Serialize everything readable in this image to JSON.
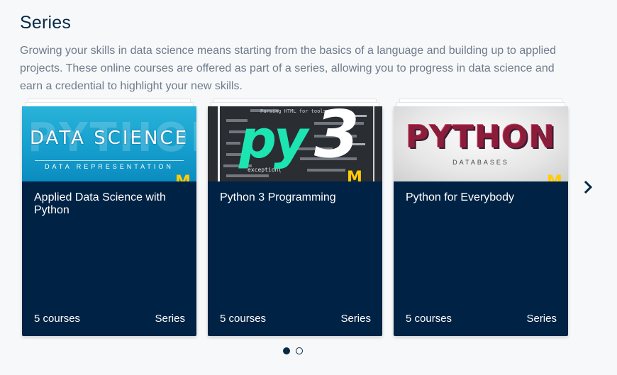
{
  "section": {
    "title": "Series",
    "description": "Growing your skills in data science means starting from the basics of a language and building up to applied projects. These online courses are offered as part of a series, allowing you to progress in data science and earn a credential to highlight your new skills."
  },
  "cards": [
    {
      "title": "Applied Data Science with Python",
      "count": "5 courses",
      "type": "Series",
      "image": {
        "background_word": "PYTHON",
        "headline": "DATA SCIENCE",
        "subtitle": "DATA REPRESENTATION",
        "logo": "M"
      }
    },
    {
      "title": "Python 3 Programming",
      "count": "5 courses",
      "type": "Series",
      "image": {
        "headline": "py",
        "number": "3",
        "code_snippet": "Parsing HTML for tools",
        "code_word": "exception(",
        "logo": "M"
      }
    },
    {
      "title": "Python for Everybody",
      "count": "5 courses",
      "type": "Series",
      "image": {
        "headline": "PYTHON",
        "subtitle": "DATABASES",
        "logo": "M"
      }
    }
  ],
  "carousel": {
    "next_icon": "chevron-right-icon",
    "pages": 2,
    "active_page": 1
  },
  "colors": {
    "navy": "#002244",
    "title": "#062a46",
    "text_muted": "#6e7c8b",
    "maize": "#ffcb05",
    "teal": "#1de5b2"
  }
}
